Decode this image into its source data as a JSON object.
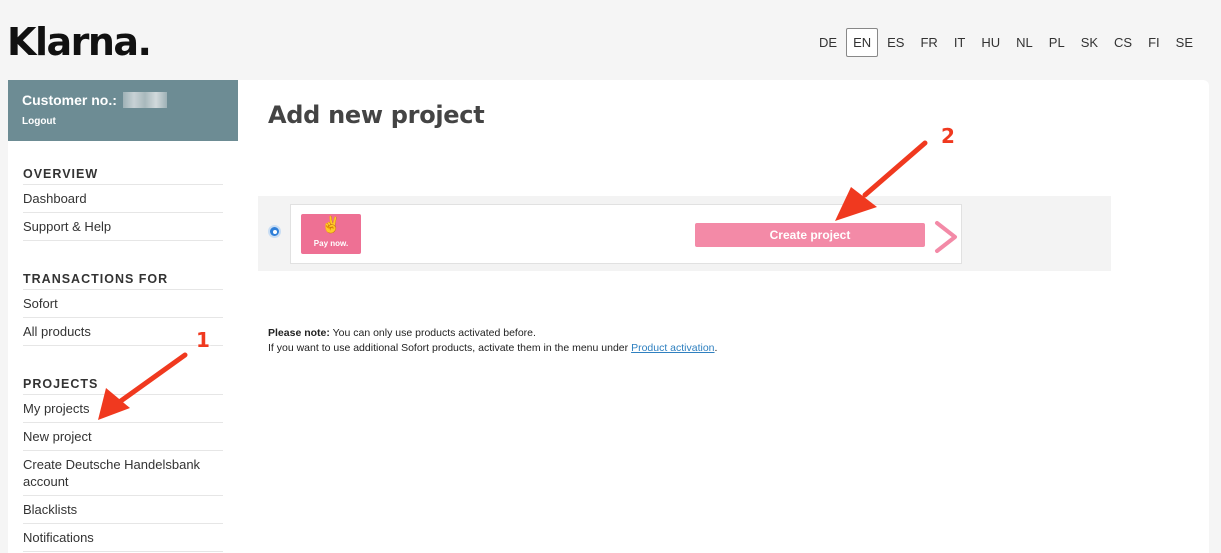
{
  "header": {
    "logo": "Klarna.",
    "languages": [
      "DE",
      "EN",
      "ES",
      "FR",
      "IT",
      "HU",
      "NL",
      "PL",
      "SK",
      "CS",
      "FI",
      "SE"
    ],
    "active_language": "EN"
  },
  "sidebar": {
    "customer_label": "Customer no.:",
    "logout": "Logout",
    "sections": [
      {
        "heading": "OVERVIEW",
        "items": [
          "Dashboard",
          "Support & Help"
        ]
      },
      {
        "heading": "TRANSACTIONS FOR",
        "items": [
          "Sofort",
          "All products"
        ]
      },
      {
        "heading": "PROJECTS",
        "items": [
          "My projects",
          "New project",
          "Create Deutsche Handelsbank account",
          "Blacklists",
          "Notifications"
        ]
      }
    ]
  },
  "main": {
    "title": "Add new project",
    "product": {
      "badge_label": "Pay now.",
      "button": "Create project"
    },
    "note": {
      "bold": "Please note:",
      "line1": "You can only use products activated before.",
      "line2_prefix": "If you want to use additional Sofort products, activate them in the menu under",
      "link": "Product activation",
      "line2_suffix": "."
    }
  },
  "annotations": {
    "one": "1",
    "two": "2"
  },
  "colors": {
    "sidebar_header": "#6d8c94",
    "button_pink": "#f38aa7",
    "badge_pink": "#ee7094",
    "arrow_red": "#f0391f",
    "radio_blue": "#2f7fd8"
  }
}
